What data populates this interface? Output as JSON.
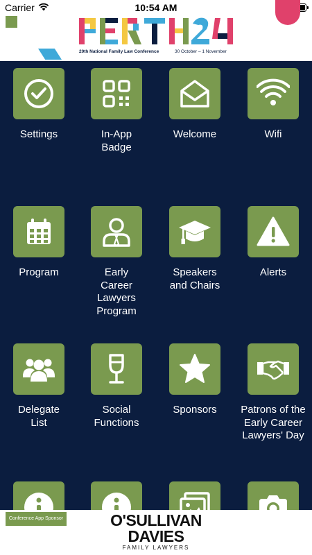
{
  "status_bar": {
    "carrier": "Carrier",
    "time": "10:54 AM"
  },
  "header": {
    "logo_text": "PERTH 24",
    "subtitle": "20th National Family Law Conference",
    "dates": "30 October – 1 November"
  },
  "tiles": [
    {
      "label": "Settings",
      "icon": "check-circle-icon"
    },
    {
      "label": "In-App Badge",
      "icon": "qr-code-icon"
    },
    {
      "label": "Welcome",
      "icon": "envelope-open-icon"
    },
    {
      "label": "Wifi",
      "icon": "wifi-icon"
    },
    {
      "label": "Program",
      "icon": "calendar-icon"
    },
    {
      "label": "Early Career Lawyers Program",
      "icon": "user-tie-icon"
    },
    {
      "label": "Speakers and Chairs",
      "icon": "graduation-cap-icon"
    },
    {
      "label": "Alerts",
      "icon": "warning-icon"
    },
    {
      "label": "Delegate List",
      "icon": "users-icon"
    },
    {
      "label": "Social Functions",
      "icon": "wine-glass-icon"
    },
    {
      "label": "Sponsors",
      "icon": "star-icon"
    },
    {
      "label": "Patrons of the Early Career Lawyers' Day",
      "icon": "handshake-icon"
    },
    {
      "label": "",
      "icon": "info-icon"
    },
    {
      "label": "",
      "icon": "info-icon"
    },
    {
      "label": "",
      "icon": "image-icon"
    },
    {
      "label": "",
      "icon": "camera-icon"
    }
  ],
  "footer": {
    "sponsor_tag": "Conference App Sponsor",
    "sponsor_name_line1": "O'SULLIVAN",
    "sponsor_name_line2": "DAVIES",
    "sponsor_name_line3": "FAMILY LAWYERS"
  },
  "colors": {
    "background": "#0b1d3f",
    "tile": "#7a9a4f",
    "accent_pink": "#e0416b",
    "accent_blue": "#3fa9d9"
  }
}
